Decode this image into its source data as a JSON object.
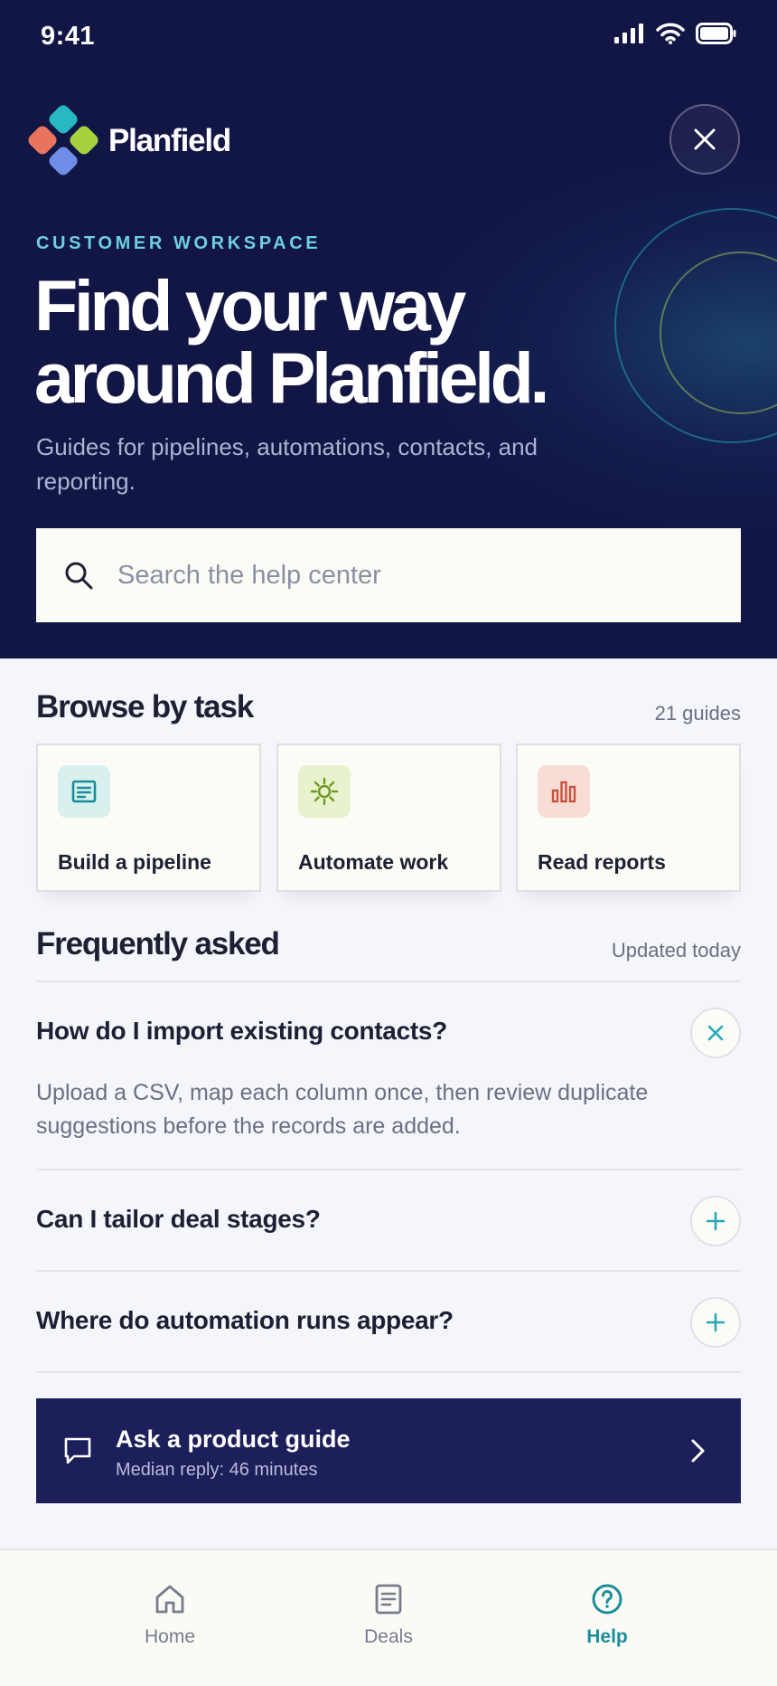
{
  "status_bar": {
    "time": "9:41"
  },
  "brand": {
    "name": "Planfield"
  },
  "hero": {
    "eyebrow": "CUSTOMER WORKSPACE",
    "headline_line1": "Find your way",
    "headline_line2": "around Planfield.",
    "subtitle": "Guides for pipelines, automations, contacts, and reporting."
  },
  "search": {
    "placeholder": "Search the help center"
  },
  "browse": {
    "title": "Browse by task",
    "meta": "21 guides",
    "tasks": [
      {
        "label": "Build a pipeline",
        "icon": "document-icon",
        "color": "#1a8c9a"
      },
      {
        "label": "Automate work",
        "icon": "sun-icon",
        "color": "#6e9a1e"
      },
      {
        "label": "Read reports",
        "icon": "bar-chart-icon",
        "color": "#c9533f"
      }
    ]
  },
  "faq": {
    "title": "Frequently asked",
    "meta": "Updated today",
    "items": [
      {
        "question": "How do I import existing contacts?",
        "answer": "Upload a CSV, map each column once, then review duplicate suggestions before the records are added.",
        "expanded": true
      },
      {
        "question": "Can I tailor deal stages?",
        "expanded": false
      },
      {
        "question": "Where do automation runs appear?",
        "expanded": false
      }
    ]
  },
  "guide": {
    "title": "Ask a product guide",
    "subtitle": "Median reply: 46 minutes"
  },
  "tabs": [
    {
      "label": "Home",
      "icon": "home-icon",
      "active": false
    },
    {
      "label": "Deals",
      "icon": "document-icon",
      "active": false
    },
    {
      "label": "Help",
      "icon": "help-icon",
      "active": true
    }
  ],
  "colors": {
    "hero_bg": "#121645",
    "accent_teal": "#1a8c9a",
    "guide_bg": "#1c1f5a",
    "eyebrow": "#6ecfe0"
  }
}
